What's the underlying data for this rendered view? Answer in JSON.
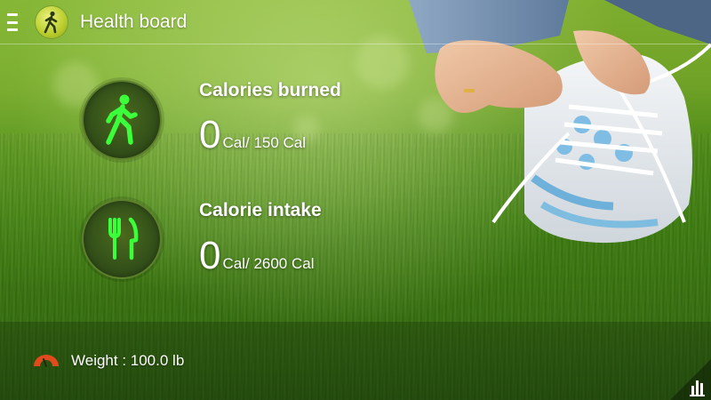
{
  "app": {
    "title": "Health board",
    "menu_icon": "drawer-menu-icon",
    "app_icon": "walking-person-icon"
  },
  "stats": [
    {
      "icon": "walking-person-icon",
      "title": "Calories burned",
      "current": "0",
      "goal": "Cal/ 150 Cal"
    },
    {
      "icon": "fork-knife-icon",
      "title": "Calorie intake",
      "current": "0",
      "goal": "Cal/ 2600 Cal"
    }
  ],
  "footer": {
    "weight_icon": "scale-gauge-icon",
    "weight_text": "Weight : 100.0 lb",
    "chart_icon": "bar-chart-icon"
  },
  "colors": {
    "accent_green": "#3cff3c",
    "icon_circle": "#33501a",
    "app_icon_yellow": "#c7d832",
    "weight_icon_orange": "#e04a1c"
  }
}
